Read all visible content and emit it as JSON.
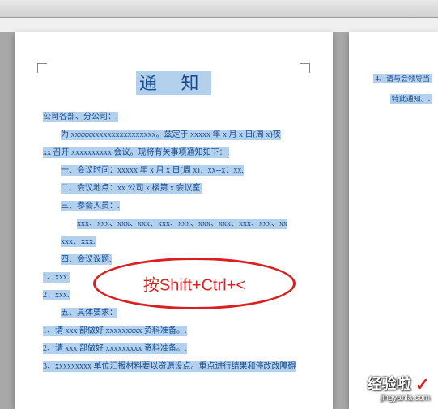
{
  "document": {
    "title": "通 知",
    "line_dept": "公司各部、分公司：.",
    "line_intro1": "为 xxxxxxxxxxxxxxxxxxxxx。兹定于 xxxxx 年 x 月 x 日(周 x)夜",
    "line_intro2": "xx 召开 xxxxxxxxxx 会议。现将有关事项通知如下：.",
    "line_1": "一、会议时间：xxxxx 年 x 月 x 日(周 x)：xx--x：xx.",
    "line_2": "二、会议地点：xx 公司 x 楼第 x 会议室.",
    "line_3": "三、参会人员：.",
    "line_names1": "xxx、xxx、xxx、xxx、xxx、xxx、xxx、xxx、xxx、xxx、xx",
    "line_names2": "xxx、xxx.",
    "line_4": "四、会议议题.",
    "line_4_1": "1、xxx.",
    "line_4_2": "2、xxx.",
    "line_5": "五、具体要求：",
    "line_5_1": "1、请 xxx 部做好 xxxxxxxxx 资料准备。.",
    "line_5_2": "2、请 xxx 部做好 xxxxxxxxx 资料准备。.",
    "line_5_3": "3、xxxxxxxxx 单位汇报材料要以资源设点。重点进行结果和停改改障碍"
  },
  "side_page": {
    "line1": "4、请与会领导当",
    "line2": "特此通知。."
  },
  "annotation": {
    "text": "按Shift+Ctrl+<"
  },
  "watermark": {
    "top": "经验啦",
    "bottom": "jingyanla.com"
  }
}
